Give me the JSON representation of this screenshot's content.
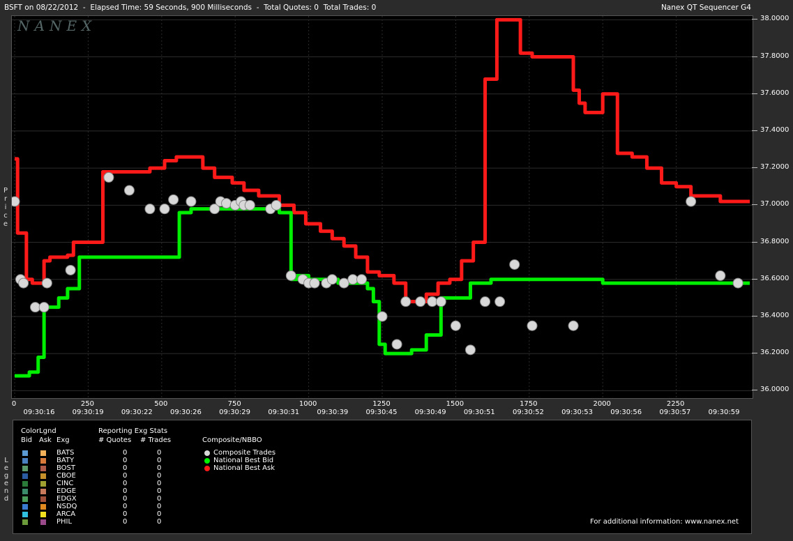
{
  "header": {
    "title_left": "BSFT on 08/22/2012  -  Elapsed Time: 59 Seconds, 900 Milliseconds  -  Total Quotes: 0  Total Trades: 0",
    "title_right": "Nanex QT Sequencer G4",
    "logo": "NANEX"
  },
  "axis": {
    "ylabel": "Price",
    "ytick_labels": [
      "38.0000",
      "37.8000",
      "37.6000",
      "37.4000",
      "37.2000",
      "37.0000",
      "36.8000",
      "36.6000",
      "36.4000",
      "36.2000",
      "36.0000"
    ],
    "xtick_numbers": [
      "0",
      "250",
      "500",
      "750",
      "1000",
      "1250",
      "1500",
      "1750",
      "2000",
      "2250"
    ],
    "xtick_times": [
      "09:30:16",
      "09:30:19",
      "09:30:22",
      "09:30:26",
      "09:30:29",
      "09:30:31",
      "09:30:39",
      "09:30:45",
      "09:30:49",
      "09:30:51",
      "09:30:52",
      "09:30:53",
      "09:30:56",
      "09:30:57",
      "09:30:59"
    ]
  },
  "legend": {
    "side_label": "Legend",
    "color_legend_title": "ColorLgnd",
    "col_bid": "Bid",
    "col_ask": "Ask",
    "col_exg": "Exg",
    "stats_title": "Reporting Exg Stats",
    "col_quotes": "# Quotes",
    "col_trades": "# Trades",
    "composite_title": "Composite/NBBO",
    "composite_items": [
      "Composite Trades",
      "National Best Bid",
      "National Best Ask"
    ],
    "exchanges": [
      {
        "name": "BATS",
        "bid_color": "#5b9bd5",
        "ask_color": "#f4b15a",
        "quotes": "0",
        "trades": "0"
      },
      {
        "name": "BATY",
        "bid_color": "#4a7fc0",
        "ask_color": "#d97a3a",
        "quotes": "0",
        "trades": "0"
      },
      {
        "name": "BOST",
        "bid_color": "#5a9a6a",
        "ask_color": "#b05a4a",
        "quotes": "0",
        "trades": "0"
      },
      {
        "name": "CBOE",
        "bid_color": "#2a5aa0",
        "ask_color": "#c8902a",
        "quotes": "0",
        "trades": "0"
      },
      {
        "name": "CINC",
        "bid_color": "#2a7a3a",
        "ask_color": "#a0a030",
        "quotes": "0",
        "trades": "0"
      },
      {
        "name": "EDGE",
        "bid_color": "#3a8a6a",
        "ask_color": "#c87a5a",
        "quotes": "0",
        "trades": "0"
      },
      {
        "name": "EDGX",
        "bid_color": "#4a9a5a",
        "ask_color": "#a0503a",
        "quotes": "0",
        "trades": "0"
      },
      {
        "name": "NSDQ",
        "bid_color": "#3a7ad0",
        "ask_color": "#e08a20",
        "quotes": "0",
        "trades": "0"
      },
      {
        "name": "ARCA",
        "bid_color": "#30c0e0",
        "ask_color": "#f0e020",
        "quotes": "0",
        "trades": "0"
      },
      {
        "name": "PHIL",
        "bid_color": "#6a9a3a",
        "ask_color": "#9a4a8a",
        "quotes": "0",
        "trades": "0"
      }
    ],
    "footer": "For additional information: www.nanex.net"
  },
  "colors": {
    "nbb": "#00ee00",
    "nba": "#ff1a1a",
    "trade": "#d8d8d8",
    "background": "#000000"
  },
  "chart_data": {
    "type": "line",
    "title": "BSFT on 08/22/2012",
    "xlabel": "",
    "ylabel": "Price",
    "xlim": [
      0,
      2500
    ],
    "ylim": [
      35.96,
      38.02
    ],
    "national_best_bid": {
      "name": "National Best Bid",
      "x": [
        0,
        50,
        80,
        100,
        150,
        180,
        220,
        420,
        560,
        600,
        700,
        900,
        940,
        960,
        1000,
        1050,
        1100,
        1200,
        1220,
        1240,
        1260,
        1300,
        1350,
        1400,
        1450,
        1500,
        1550,
        1600,
        1620,
        1700,
        1800,
        1900,
        2000,
        2100,
        2200,
        2300,
        2400,
        2480
      ],
      "y": [
        36.08,
        36.1,
        36.18,
        36.45,
        36.5,
        36.55,
        36.72,
        36.72,
        36.96,
        36.98,
        36.98,
        36.96,
        36.6,
        36.62,
        36.6,
        36.6,
        36.58,
        36.55,
        36.48,
        36.25,
        36.2,
        36.2,
        36.22,
        36.3,
        36.5,
        36.5,
        36.58,
        36.58,
        36.6,
        36.6,
        36.6,
        36.6,
        36.58,
        36.58,
        36.58,
        36.58,
        36.58,
        36.58
      ]
    },
    "national_best_ask": {
      "name": "National Best Ask",
      "x": [
        0,
        10,
        40,
        60,
        100,
        120,
        150,
        180,
        200,
        300,
        320,
        370,
        460,
        510,
        550,
        600,
        640,
        680,
        740,
        780,
        800,
        830,
        900,
        950,
        990,
        1040,
        1080,
        1120,
        1160,
        1200,
        1240,
        1290,
        1330,
        1370,
        1400,
        1440,
        1480,
        1520,
        1560,
        1600,
        1640,
        1680,
        1720,
        1760,
        1800,
        1900,
        1920,
        1940,
        2000,
        2050,
        2100,
        2150,
        2200,
        2250,
        2300,
        2400,
        2480
      ],
      "y": [
        37.25,
        36.85,
        36.6,
        36.58,
        36.7,
        36.72,
        36.72,
        36.73,
        36.8,
        37.18,
        37.18,
        37.18,
        37.2,
        37.24,
        37.26,
        37.26,
        37.2,
        37.15,
        37.12,
        37.08,
        37.08,
        37.05,
        37.0,
        36.96,
        36.9,
        36.86,
        36.82,
        36.78,
        36.72,
        36.64,
        36.62,
        36.58,
        36.48,
        36.48,
        36.52,
        36.58,
        36.6,
        36.7,
        36.8,
        37.68,
        38.0,
        38.0,
        37.82,
        37.8,
        37.8,
        37.62,
        37.55,
        37.5,
        37.6,
        37.28,
        37.26,
        37.2,
        37.12,
        37.1,
        37.05,
        37.02,
        37.02
      ]
    },
    "composite_trades": {
      "name": "Composite Trades",
      "x": [
        0,
        20,
        30,
        70,
        100,
        110,
        190,
        320,
        390,
        460,
        510,
        540,
        600,
        680,
        700,
        720,
        750,
        770,
        780,
        800,
        870,
        890,
        940,
        980,
        1000,
        1020,
        1060,
        1080,
        1120,
        1150,
        1180,
        1250,
        1300,
        1330,
        1380,
        1420,
        1450,
        1500,
        1550,
        1600,
        1650,
        1700,
        1760,
        1900,
        2300,
        2400,
        2460
      ],
      "y": [
        37.02,
        36.6,
        36.58,
        36.45,
        36.45,
        36.58,
        36.65,
        37.15,
        37.08,
        36.98,
        36.98,
        37.03,
        37.02,
        36.98,
        37.02,
        37.01,
        37.0,
        37.02,
        37.0,
        37.0,
        36.98,
        37.0,
        36.62,
        36.6,
        36.58,
        36.58,
        36.58,
        36.6,
        36.58,
        36.6,
        36.6,
        36.4,
        36.25,
        36.48,
        36.48,
        36.48,
        36.48,
        36.35,
        36.22,
        36.48,
        36.48,
        36.68,
        36.35,
        36.35,
        37.02,
        36.62,
        36.58
      ]
    }
  }
}
